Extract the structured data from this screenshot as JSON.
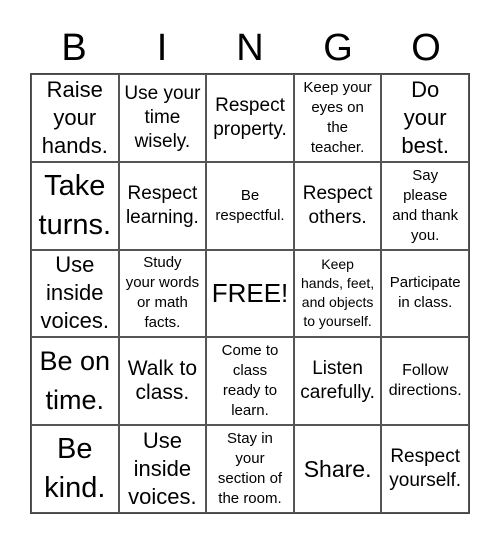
{
  "header": {
    "letters": [
      "B",
      "I",
      "N",
      "G",
      "O"
    ]
  },
  "cells": [
    "Raise\nyour\nhands.",
    "Use your\ntime\nwisely.",
    "Respect\nproperty.",
    "Keep your\neyes on\nthe\nteacher.",
    "Do\nyour\nbest.",
    "Take\nturns.",
    "Respect\nlearning.",
    "Be\nrespectful.",
    "Respect\nothers.",
    "Say\nplease\nand thank\nyou.",
    "Use\ninside\nvoices.",
    "Study\nyour words\nor math\nfacts.",
    "FREE!",
    "Keep\nhands, feet,\nand objects\nto yourself.",
    "Participate\nin class.",
    "Be on\ntime.",
    "Walk to\nclass.",
    "Come to\nclass\nready to\nlearn.",
    "Listen\ncarefully.",
    "Follow\ndirections.",
    "Be\nkind.",
    "Use\ninside\nvoices.",
    "Stay in\nyour\nsection of\nthe room.",
    "Share.",
    "Respect\nyourself."
  ]
}
